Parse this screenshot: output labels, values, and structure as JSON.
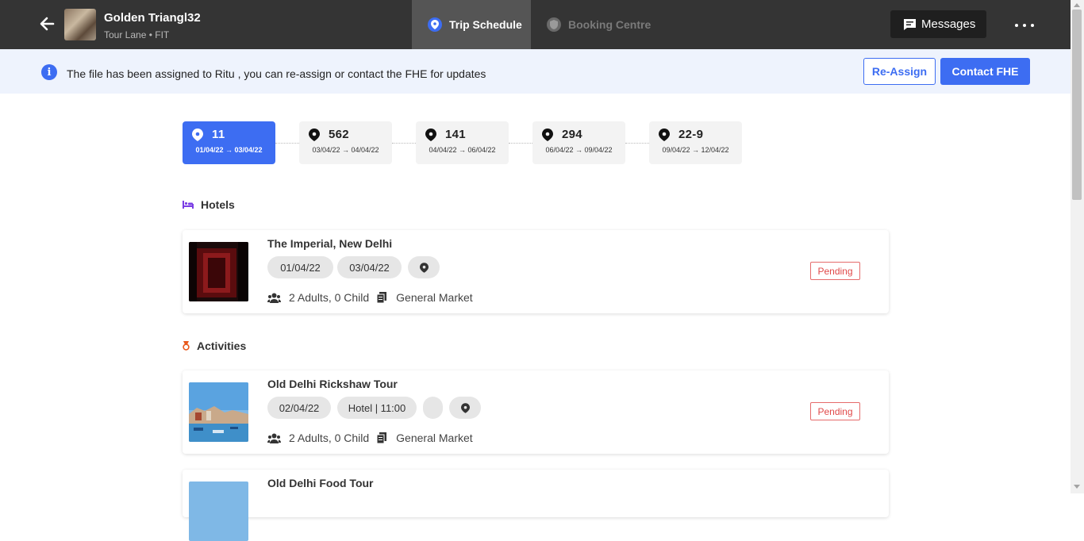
{
  "header": {
    "title": "Golden Triangl32",
    "subtitle": "Tour Lane • FIT",
    "tabs": [
      {
        "label": "Trip Schedule",
        "icon": "location-pin-icon",
        "active": true
      },
      {
        "label": "Booking Centre",
        "icon": "shield-icon",
        "active": false
      }
    ],
    "messages_label": "Messages"
  },
  "notice": {
    "text": "The file has been assigned to Ritu , you can re-assign or contact the FHE for updates",
    "reassign_label": "Re-Assign",
    "contact_label": "Contact FHE"
  },
  "destinations": [
    {
      "name": "11",
      "dates": "01/04/22 → 03/04/22",
      "active": true
    },
    {
      "name": "562",
      "dates": "03/04/22 → 04/04/22",
      "active": false
    },
    {
      "name": "141",
      "dates": "04/04/22 → 06/04/22",
      "active": false
    },
    {
      "name": "294",
      "dates": "06/04/22 → 09/04/22",
      "active": false
    },
    {
      "name": "22-9",
      "dates": "09/04/22 → 12/04/22",
      "active": false
    }
  ],
  "hotels": {
    "heading": "Hotels",
    "items": [
      {
        "name": "The Imperial, New Delhi",
        "check_in": "01/04/22",
        "check_out": "03/04/22",
        "guests": "2 Adults, 0 Child",
        "market": "General Market",
        "status": "Pending"
      }
    ]
  },
  "activities": {
    "heading": "Activities",
    "items": [
      {
        "name": "Old Delhi Rickshaw Tour",
        "date": "02/04/22",
        "pickup": "Hotel | 11:00",
        "guests": "2 Adults, 0 Child",
        "market": "General Market",
        "status": "Pending"
      },
      {
        "name": "Old Delhi Food Tour"
      }
    ]
  },
  "colors": {
    "accent": "#3d6df2",
    "topbar": "#343434",
    "pending": "#e04848",
    "notice_bg": "#eef3fd"
  }
}
